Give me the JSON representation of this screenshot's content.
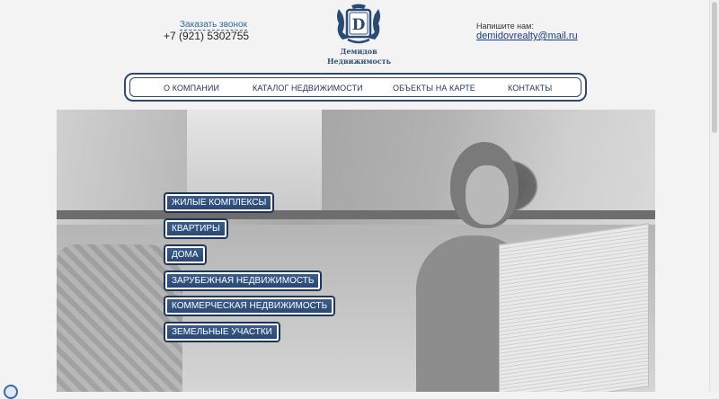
{
  "header": {
    "call_link": "Заказать звонок",
    "phone": "+7 (921) 5302755",
    "logo_letter": "D",
    "logo_title_line1": "Демидов",
    "logo_title_line2": "Недвижимость",
    "write_label": "Напишите нам:",
    "email": "demidovrealty@mail.ru"
  },
  "nav": {
    "items": [
      {
        "label": "О КОМПАНИИ"
      },
      {
        "label": "КАТАЛОГ НЕДВИЖИМОСТИ"
      },
      {
        "label": "ОБЪЕКТЫ НА КАРТЕ"
      },
      {
        "label": "КОНТАКТЫ"
      }
    ]
  },
  "categories": [
    {
      "label": "ЖИЛЫЕ КОМПЛЕКСЫ"
    },
    {
      "label": "КВАРТИРЫ"
    },
    {
      "label": "ДОМА"
    },
    {
      "label": "ЗАРУБЕЖНАЯ НЕДВИЖИМОСТЬ"
    },
    {
      "label": "КОММЕРЧЕСКАЯ НЕДВИЖИМОСТЬ"
    },
    {
      "label": "ЗЕМЕЛЬНЫЕ УЧАСТКИ"
    }
  ],
  "colors": {
    "brand_navy": "#2a4a74",
    "button_blue": "#284670",
    "link_blue": "#336699"
  },
  "icons": {
    "logo": "monogram-crest-icon",
    "corner": "chat-bubble-icon"
  }
}
